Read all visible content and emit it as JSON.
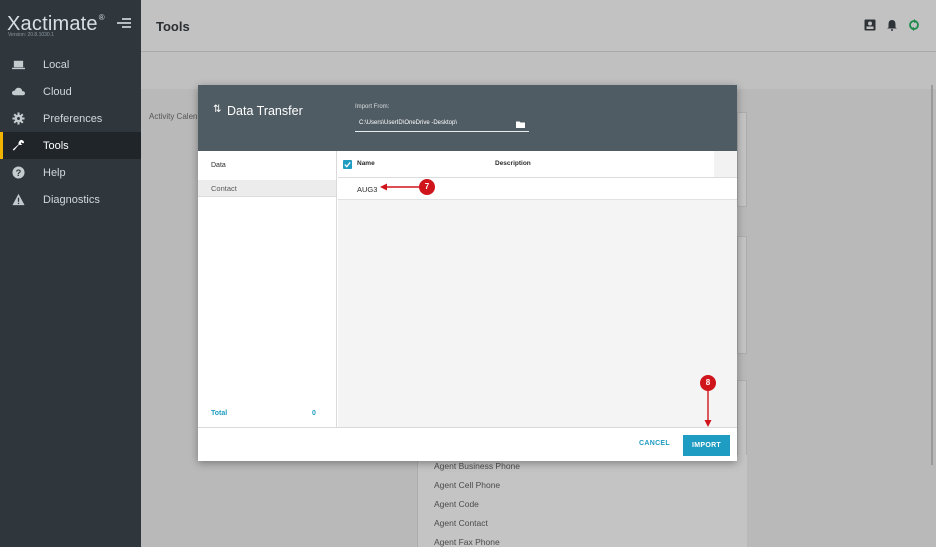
{
  "app": {
    "name": "Xactimate",
    "version": "Version: 20.8.1030.1"
  },
  "sidebar": {
    "items": [
      {
        "label": "Local",
        "icon": "laptop-icon"
      },
      {
        "label": "Cloud",
        "icon": "cloud-icon"
      },
      {
        "label": "Preferences",
        "icon": "gear-icon"
      },
      {
        "label": "Tools",
        "icon": "wrench-icon",
        "active": true
      },
      {
        "label": "Help",
        "icon": "help-icon"
      },
      {
        "label": "Diagnostics",
        "icon": "warning-icon"
      }
    ]
  },
  "header": {
    "title": "Tools",
    "icons": [
      "contacts-icon",
      "bell-icon",
      "sync-icon"
    ]
  },
  "background": {
    "activity_label": "Activity Calen",
    "list_items": [
      "Agent Business Phone",
      "Agent Cell Phone",
      "Agent Code",
      "Agent Contact",
      "Agent Fax Phone"
    ]
  },
  "dialog": {
    "title": "Data Transfer",
    "import_from_label": "Import From:",
    "import_path": "C:\\Users\\UserID\\OneDrive -Desktop\\",
    "left": {
      "heading": "Data",
      "items": [
        "Contact"
      ],
      "total_label": "Total",
      "total_value": "0"
    },
    "grid": {
      "col_name": "Name",
      "col_description": "Description",
      "rows": [
        {
          "name": "AUG3",
          "description": ""
        }
      ]
    },
    "cancel_label": "CANCEL",
    "import_label": "IMPORT"
  },
  "callouts": [
    {
      "number": "7"
    },
    {
      "number": "8"
    }
  ],
  "colors": {
    "accent": "#1e9cc1",
    "sidebar": "#2f373d",
    "active_marker": "#f0b400",
    "callout": "#d0141c",
    "dialog_header": "#505c63"
  }
}
